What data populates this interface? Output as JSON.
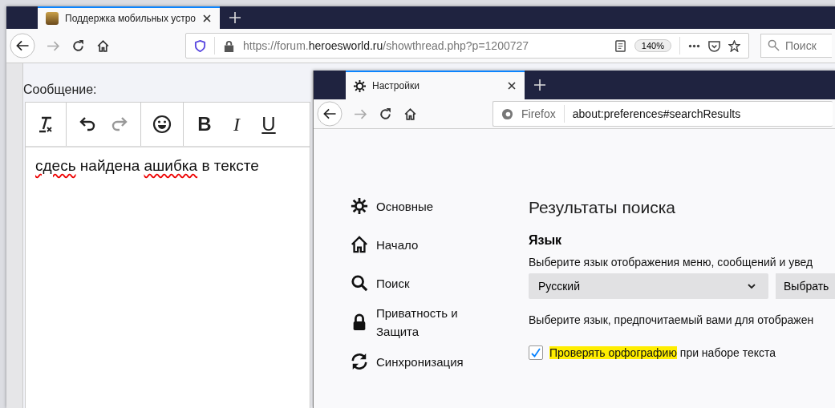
{
  "browser_back": {
    "tabs": [
      {
        "title": "Поддержка мобильных устро",
        "selected": true
      }
    ],
    "url": {
      "prefix": "https://forum.",
      "domain": "heroesworld.ru",
      "path": "/showthread.php?p=1200727"
    },
    "zoom": "140%",
    "search": {
      "placeholder": "Поиск"
    },
    "page": {
      "label": "Сообщение:",
      "tools": [
        {
          "kind": "clear-format",
          "disabled": false
        },
        {
          "kind": "undo",
          "disabled": false
        },
        {
          "kind": "redo",
          "disabled": true
        },
        {
          "kind": "emoji",
          "disabled": false
        },
        {
          "kind": "bold",
          "label": "B",
          "disabled": false
        },
        {
          "kind": "italic",
          "label": "I",
          "disabled": false
        },
        {
          "kind": "underline",
          "label": "U",
          "disabled": false
        }
      ],
      "words": [
        {
          "text": "сдесь",
          "misspelled": true
        },
        {
          "text": "найдена",
          "misspelled": false
        },
        {
          "text": "ашибка",
          "misspelled": true
        },
        {
          "text": "в",
          "misspelled": false
        },
        {
          "text": "тексте",
          "misspelled": false
        }
      ]
    }
  },
  "browser_front": {
    "tabs": [
      {
        "title": "Настройки",
        "selected": true
      }
    ],
    "identity": "Firefox",
    "url": "about:preferences#searchResults",
    "sidebar": {
      "items": [
        {
          "kind": "gear",
          "label": "Основные"
        },
        {
          "kind": "home",
          "label": "Начало"
        },
        {
          "kind": "search",
          "label": "Поиск"
        },
        {
          "kind": "lock",
          "label": "Приватность и Защита"
        },
        {
          "kind": "sync",
          "label": "Синхронизация"
        }
      ]
    },
    "main": {
      "heading": "Результаты поиска",
      "section": "Язык",
      "description": "Выберите язык отображения меню, сообщений и увед",
      "select": {
        "value": "Русский"
      },
      "button": "Выбрать",
      "description2": "Выберите язык, предпочитаемый вами для отображен",
      "checkbox": {
        "checked": true,
        "highlight": "Проверять орфографию",
        "rest": "при наборе текста"
      }
    }
  }
}
